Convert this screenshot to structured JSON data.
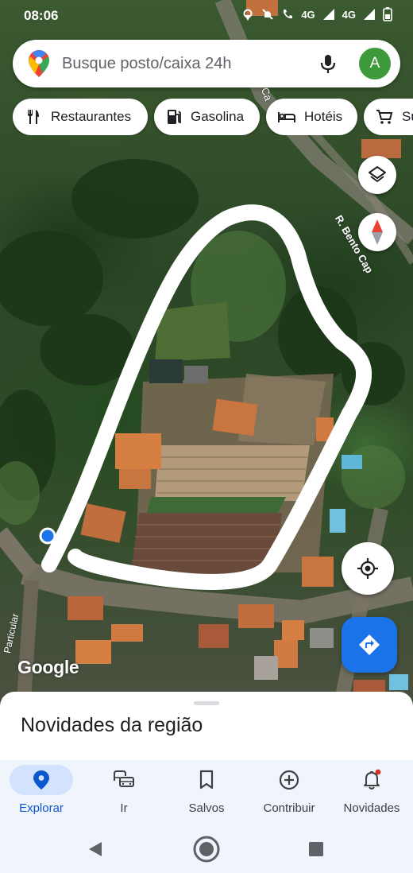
{
  "status_bar": {
    "time": "08:06",
    "network_1": "4G",
    "network_2": "4G"
  },
  "search": {
    "placeholder": "Busque posto/caixa 24h",
    "avatar_letter": "A"
  },
  "chips": [
    {
      "label": "Restaurantes",
      "icon": "restaurant-icon"
    },
    {
      "label": "Gasolina",
      "icon": "gas-station-icon"
    },
    {
      "label": "Hotéis",
      "icon": "hotel-bed-icon"
    },
    {
      "label": "Supermercados",
      "icon": "cart-icon"
    }
  ],
  "map": {
    "street_label_1": "R. Bento Cap",
    "street_label_2": "Particular",
    "street_label_3": "Ca",
    "watermark": "Google",
    "outline_color": "#ffffff"
  },
  "bottom_sheet": {
    "title": "Novidades da região"
  },
  "bottom_nav": {
    "items": [
      {
        "label": "Explorar",
        "icon": "location-pin-icon",
        "active": true
      },
      {
        "label": "Ir",
        "icon": "commute-icon",
        "active": false
      },
      {
        "label": "Salvos",
        "icon": "bookmark-icon",
        "active": false
      },
      {
        "label": "Contribuir",
        "icon": "add-circle-icon",
        "active": false
      },
      {
        "label": "Novidades",
        "icon": "bell-icon",
        "active": false
      }
    ]
  },
  "colors": {
    "accent": "#1a73e8",
    "active_nav_bg": "#d3e3fd",
    "avatar": "#3c9a3a"
  }
}
